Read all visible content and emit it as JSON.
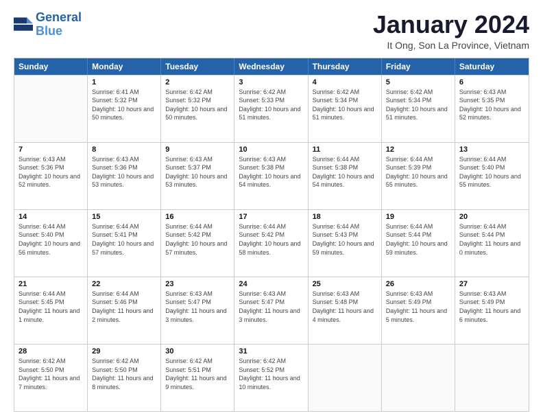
{
  "logo": {
    "line1": "General",
    "line2": "Blue"
  },
  "title": "January 2024",
  "subtitle": "It Ong, Son La Province, Vietnam",
  "days_of_week": [
    "Sunday",
    "Monday",
    "Tuesday",
    "Wednesday",
    "Thursday",
    "Friday",
    "Saturday"
  ],
  "weeks": [
    [
      {
        "day": "",
        "sunrise": "",
        "sunset": "",
        "daylight": ""
      },
      {
        "day": "1",
        "sunrise": "Sunrise: 6:41 AM",
        "sunset": "Sunset: 5:32 PM",
        "daylight": "Daylight: 10 hours and 50 minutes."
      },
      {
        "day": "2",
        "sunrise": "Sunrise: 6:42 AM",
        "sunset": "Sunset: 5:32 PM",
        "daylight": "Daylight: 10 hours and 50 minutes."
      },
      {
        "day": "3",
        "sunrise": "Sunrise: 6:42 AM",
        "sunset": "Sunset: 5:33 PM",
        "daylight": "Daylight: 10 hours and 51 minutes."
      },
      {
        "day": "4",
        "sunrise": "Sunrise: 6:42 AM",
        "sunset": "Sunset: 5:34 PM",
        "daylight": "Daylight: 10 hours and 51 minutes."
      },
      {
        "day": "5",
        "sunrise": "Sunrise: 6:42 AM",
        "sunset": "Sunset: 5:34 PM",
        "daylight": "Daylight: 10 hours and 51 minutes."
      },
      {
        "day": "6",
        "sunrise": "Sunrise: 6:43 AM",
        "sunset": "Sunset: 5:35 PM",
        "daylight": "Daylight: 10 hours and 52 minutes."
      }
    ],
    [
      {
        "day": "7",
        "sunrise": "Sunrise: 6:43 AM",
        "sunset": "Sunset: 5:36 PM",
        "daylight": "Daylight: 10 hours and 52 minutes."
      },
      {
        "day": "8",
        "sunrise": "Sunrise: 6:43 AM",
        "sunset": "Sunset: 5:36 PM",
        "daylight": "Daylight: 10 hours and 53 minutes."
      },
      {
        "day": "9",
        "sunrise": "Sunrise: 6:43 AM",
        "sunset": "Sunset: 5:37 PM",
        "daylight": "Daylight: 10 hours and 53 minutes."
      },
      {
        "day": "10",
        "sunrise": "Sunrise: 6:43 AM",
        "sunset": "Sunset: 5:38 PM",
        "daylight": "Daylight: 10 hours and 54 minutes."
      },
      {
        "day": "11",
        "sunrise": "Sunrise: 6:44 AM",
        "sunset": "Sunset: 5:38 PM",
        "daylight": "Daylight: 10 hours and 54 minutes."
      },
      {
        "day": "12",
        "sunrise": "Sunrise: 6:44 AM",
        "sunset": "Sunset: 5:39 PM",
        "daylight": "Daylight: 10 hours and 55 minutes."
      },
      {
        "day": "13",
        "sunrise": "Sunrise: 6:44 AM",
        "sunset": "Sunset: 5:40 PM",
        "daylight": "Daylight: 10 hours and 55 minutes."
      }
    ],
    [
      {
        "day": "14",
        "sunrise": "Sunrise: 6:44 AM",
        "sunset": "Sunset: 5:40 PM",
        "daylight": "Daylight: 10 hours and 56 minutes."
      },
      {
        "day": "15",
        "sunrise": "Sunrise: 6:44 AM",
        "sunset": "Sunset: 5:41 PM",
        "daylight": "Daylight: 10 hours and 57 minutes."
      },
      {
        "day": "16",
        "sunrise": "Sunrise: 6:44 AM",
        "sunset": "Sunset: 5:42 PM",
        "daylight": "Daylight: 10 hours and 57 minutes."
      },
      {
        "day": "17",
        "sunrise": "Sunrise: 6:44 AM",
        "sunset": "Sunset: 5:42 PM",
        "daylight": "Daylight: 10 hours and 58 minutes."
      },
      {
        "day": "18",
        "sunrise": "Sunrise: 6:44 AM",
        "sunset": "Sunset: 5:43 PM",
        "daylight": "Daylight: 10 hours and 59 minutes."
      },
      {
        "day": "19",
        "sunrise": "Sunrise: 6:44 AM",
        "sunset": "Sunset: 5:44 PM",
        "daylight": "Daylight: 10 hours and 59 minutes."
      },
      {
        "day": "20",
        "sunrise": "Sunrise: 6:44 AM",
        "sunset": "Sunset: 5:44 PM",
        "daylight": "Daylight: 11 hours and 0 minutes."
      }
    ],
    [
      {
        "day": "21",
        "sunrise": "Sunrise: 6:44 AM",
        "sunset": "Sunset: 5:45 PM",
        "daylight": "Daylight: 11 hours and 1 minute."
      },
      {
        "day": "22",
        "sunrise": "Sunrise: 6:44 AM",
        "sunset": "Sunset: 5:46 PM",
        "daylight": "Daylight: 11 hours and 2 minutes."
      },
      {
        "day": "23",
        "sunrise": "Sunrise: 6:43 AM",
        "sunset": "Sunset: 5:47 PM",
        "daylight": "Daylight: 11 hours and 3 minutes."
      },
      {
        "day": "24",
        "sunrise": "Sunrise: 6:43 AM",
        "sunset": "Sunset: 5:47 PM",
        "daylight": "Daylight: 11 hours and 3 minutes."
      },
      {
        "day": "25",
        "sunrise": "Sunrise: 6:43 AM",
        "sunset": "Sunset: 5:48 PM",
        "daylight": "Daylight: 11 hours and 4 minutes."
      },
      {
        "day": "26",
        "sunrise": "Sunrise: 6:43 AM",
        "sunset": "Sunset: 5:49 PM",
        "daylight": "Daylight: 11 hours and 5 minutes."
      },
      {
        "day": "27",
        "sunrise": "Sunrise: 6:43 AM",
        "sunset": "Sunset: 5:49 PM",
        "daylight": "Daylight: 11 hours and 6 minutes."
      }
    ],
    [
      {
        "day": "28",
        "sunrise": "Sunrise: 6:42 AM",
        "sunset": "Sunset: 5:50 PM",
        "daylight": "Daylight: 11 hours and 7 minutes."
      },
      {
        "day": "29",
        "sunrise": "Sunrise: 6:42 AM",
        "sunset": "Sunset: 5:50 PM",
        "daylight": "Daylight: 11 hours and 8 minutes."
      },
      {
        "day": "30",
        "sunrise": "Sunrise: 6:42 AM",
        "sunset": "Sunset: 5:51 PM",
        "daylight": "Daylight: 11 hours and 9 minutes."
      },
      {
        "day": "31",
        "sunrise": "Sunrise: 6:42 AM",
        "sunset": "Sunset: 5:52 PM",
        "daylight": "Daylight: 11 hours and 10 minutes."
      },
      {
        "day": "",
        "sunrise": "",
        "sunset": "",
        "daylight": ""
      },
      {
        "day": "",
        "sunrise": "",
        "sunset": "",
        "daylight": ""
      },
      {
        "day": "",
        "sunrise": "",
        "sunset": "",
        "daylight": ""
      }
    ]
  ]
}
